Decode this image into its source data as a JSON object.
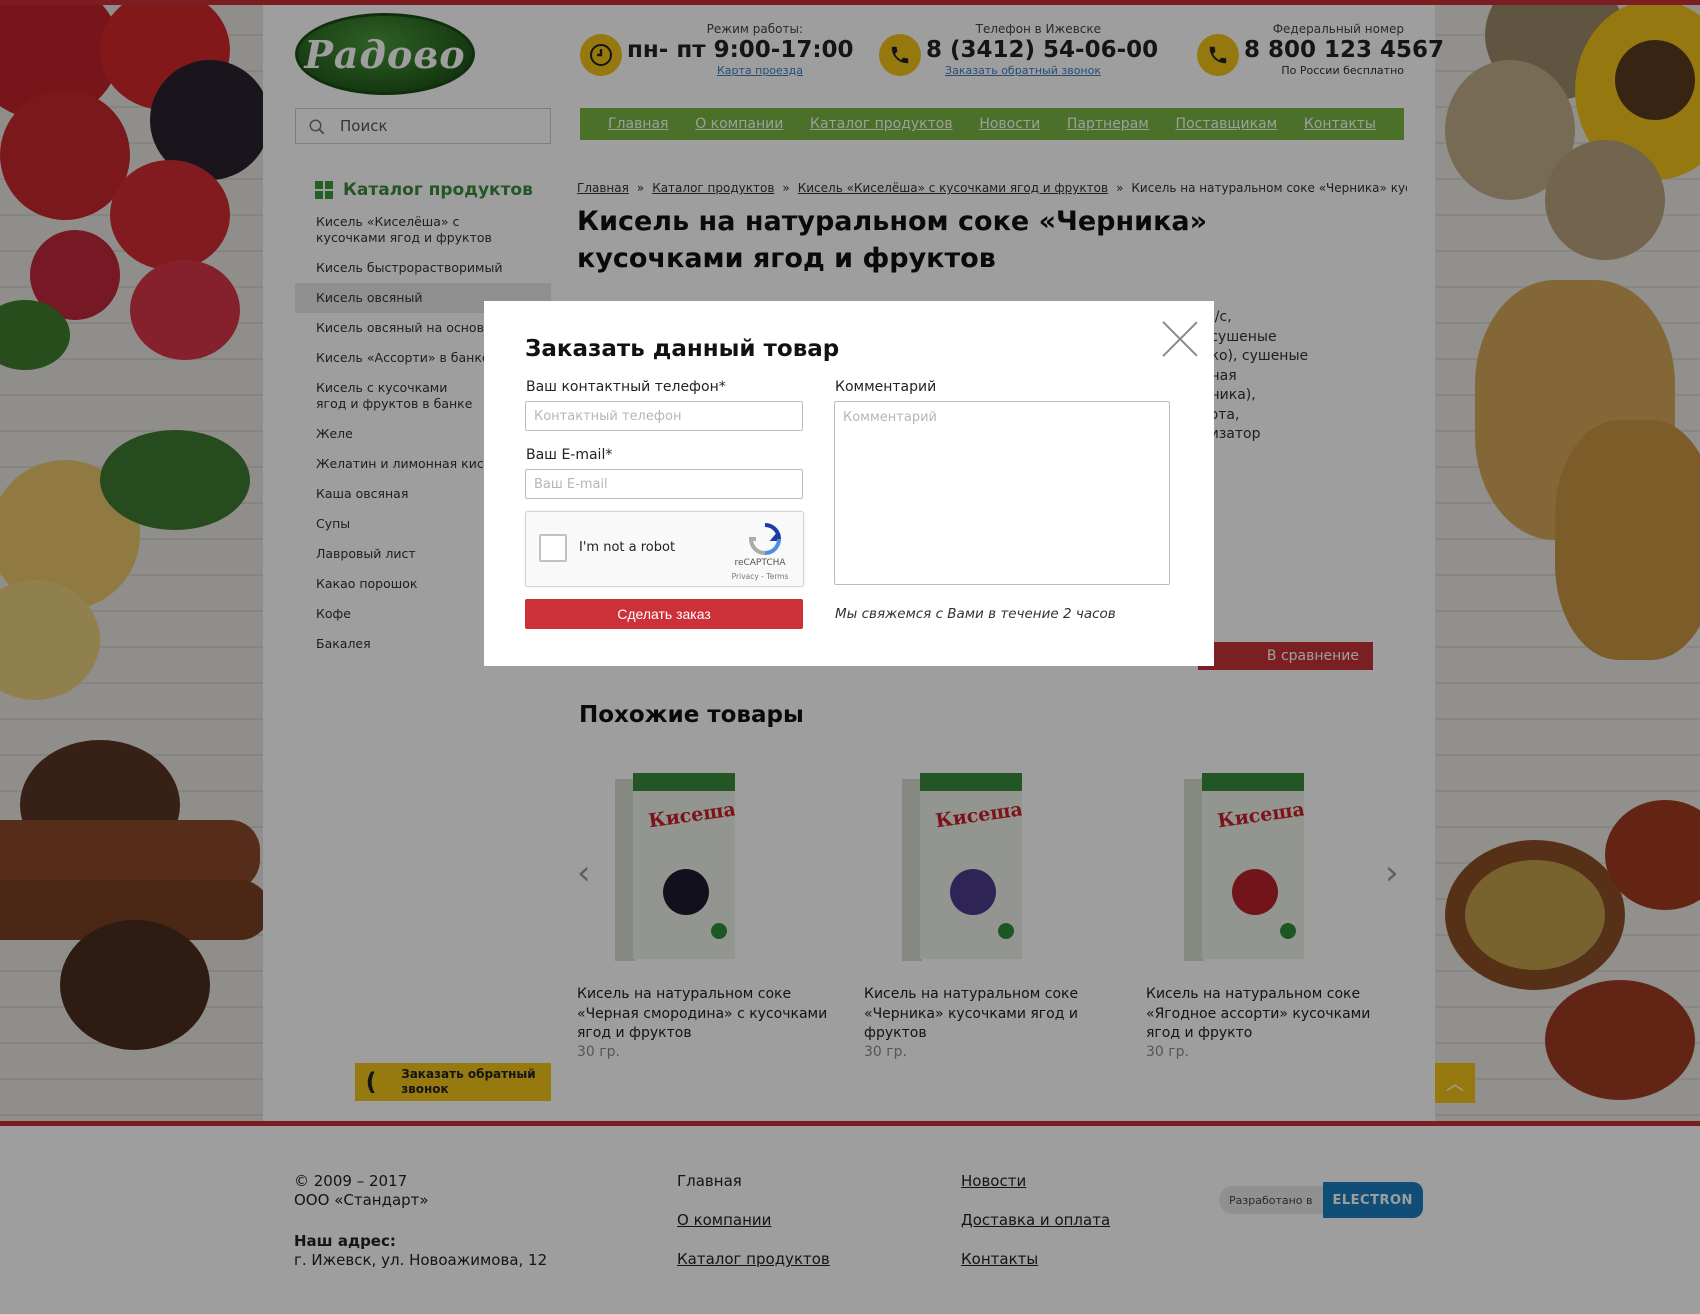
{
  "header": {
    "logo_text": "Радово",
    "hours_label": "Режим работы:",
    "hours_value": "пн- пт 9:00-17:00",
    "hours_link": "Карта проезда",
    "city_phone_label": "Телефон в Ижевске",
    "city_phone_value": "8 (3412) 54-06-00",
    "city_phone_link": "Заказать обратный звонок",
    "federal_label": "Федеральный номер",
    "federal_value": "8 800 123 4567",
    "federal_note": "По России бесплатно"
  },
  "search": {
    "placeholder": "Поиск"
  },
  "nav": [
    "Главная",
    "О компании",
    "Каталог продуктов",
    "Новости",
    "Партнерам",
    "Поставщикам",
    "Контакты"
  ],
  "sidebar": {
    "title": "Каталог продуктов",
    "items": [
      "Кисель «Киселёша» с кусочками ягод и фруктов",
      "Кисель быстрорастворимый",
      "Кисель овсяный",
      "Кисель овсяный на основе",
      "Кисель «Ассорти» в банке",
      "Кисель с кусочками ягод и фруктов в банке",
      "Желе",
      "Желатин и лимонная кислота",
      "Каша овсяная",
      "Супы",
      "Лавровый лист",
      "Какао порошок",
      "Кофе",
      "Бакалея"
    ],
    "active_index": 2,
    "callback_label": "Заказать обратный звонок"
  },
  "breadcrumbs": [
    "Главная",
    "Каталог продуктов",
    "Кисель «Киселёша» с кусочками ягод и фруктов",
    "Кисель на натуральном соке «Черника» кусочка..."
  ],
  "product": {
    "title": "Кисель на натуральном соке «Черника» кусочками ягод и фруктов",
    "desc_lines": [
      "й в/с,",
      "к, сушеные",
      "локо), сушеные",
      "ерная",
      "ерника),",
      "слота,",
      "атизатор"
    ],
    "compare_label": "В сравнение"
  },
  "similar": {
    "title": "Похожие товары",
    "items": [
      {
        "name": "Кисель на натуральном соке «Черная смородина» с кусочками ягод и фруктов",
        "price": "30 гр.",
        "brand": "Кисеша",
        "berry_color": "#1e1a2e"
      },
      {
        "name": "Кисель на натуральном соке «Черника» кусочками ягод и фруктов",
        "price": "30 гр.",
        "brand": "Кисеша",
        "berry_color": "#4b3a8a"
      },
      {
        "name": "Кисель на натуральном соке «Ягодное ассорти» кусочками ягод и фрукто",
        "price": "30 гр.",
        "brand": "Кисеша",
        "berry_color": "#b8222d"
      }
    ]
  },
  "footer": {
    "copyright": "© 2009 – 2017",
    "company": "ООО «Стандарт»",
    "address_label": "Наш адрес:",
    "address": "г. Ижевск, ул. Новоажимова, 12",
    "col1": [
      "Главная",
      "О компании",
      "Каталог продуктов"
    ],
    "col2": [
      "Новости",
      "Доставка и оплата",
      "Контакты"
    ],
    "dev_label": "Разработано в",
    "dev_brand": "ELECTRON"
  },
  "modal": {
    "title": "Заказать данный товар",
    "phone_label": "Ваш контактный телефон*",
    "phone_placeholder": "Контактный телефон",
    "email_label": "Ваш E-mail*",
    "email_placeholder": "Ваш E-mail",
    "comment_label": "Комментарий",
    "comment_placeholder": "Комментарий",
    "captcha_label": "I'm not a robot",
    "captcha_brand": "reCAPTCHA",
    "captcha_terms": "Privacy - Terms",
    "submit_label": "Сделать заказ",
    "note": "Мы свяжемся с Вами в течение 2 часов"
  },
  "colors": {
    "accent_red": "#c72f36",
    "nav_green": "#79b543",
    "yellow": "#f0c419",
    "link_blue": "#3a7fbf"
  }
}
